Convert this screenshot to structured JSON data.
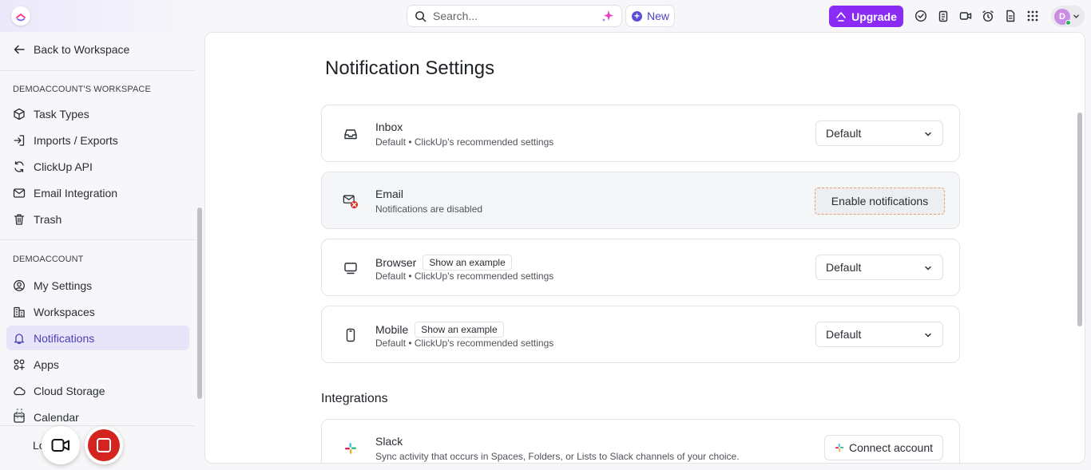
{
  "topbar": {
    "search_placeholder": "Search...",
    "new_label": "New",
    "upgrade_label": "Upgrade",
    "avatar_initial": "D"
  },
  "sidebar": {
    "back_label": "Back to Workspace",
    "workspace_section": "DEMOACCOUNT'S WORKSPACE",
    "workspace_items": [
      {
        "label": "Task Types",
        "icon": "cube-icon"
      },
      {
        "label": "Imports / Exports",
        "icon": "import-icon"
      },
      {
        "label": "ClickUp API",
        "icon": "api-icon"
      },
      {
        "label": "Email Integration",
        "icon": "mail-icon"
      },
      {
        "label": "Trash",
        "icon": "trash-icon"
      }
    ],
    "account_section": "DEMOACCOUNT",
    "account_items": [
      {
        "label": "My Settings",
        "icon": "user-circle-icon"
      },
      {
        "label": "Workspaces",
        "icon": "workspaces-icon"
      },
      {
        "label": "Notifications",
        "icon": "bell-icon",
        "active": true
      },
      {
        "label": "Apps",
        "icon": "apps-icon"
      },
      {
        "label": "Cloud Storage",
        "icon": "cloud-icon"
      },
      {
        "label": "Calendar",
        "icon": "calendar-icon"
      }
    ],
    "bottom_partial_label": "Lo"
  },
  "main": {
    "title": "Notification Settings",
    "cards": {
      "inbox": {
        "title": "Inbox",
        "subtitle": "Default • ClickUp's recommended settings",
        "value": "Default"
      },
      "email": {
        "title": "Email",
        "subtitle": "Notifications are disabled",
        "action": "Enable notifications"
      },
      "browser": {
        "title": "Browser",
        "example": "Show an example",
        "subtitle": "Default • ClickUp's recommended settings",
        "value": "Default"
      },
      "mobile": {
        "title": "Mobile",
        "example": "Show an example",
        "subtitle": "Default • ClickUp's recommended settings",
        "value": "Default"
      }
    },
    "integrations_title": "Integrations",
    "slack": {
      "title": "Slack",
      "subtitle": "Sync activity that occurs in Spaces, Folders, or Lists to Slack channels of your choice.",
      "action": "Connect account"
    }
  },
  "colors": {
    "accent": "#8b2cf5",
    "active_nav_bg": "#e8e5fb",
    "active_nav_text": "#4a3fb8",
    "record_red": "#d42420"
  }
}
